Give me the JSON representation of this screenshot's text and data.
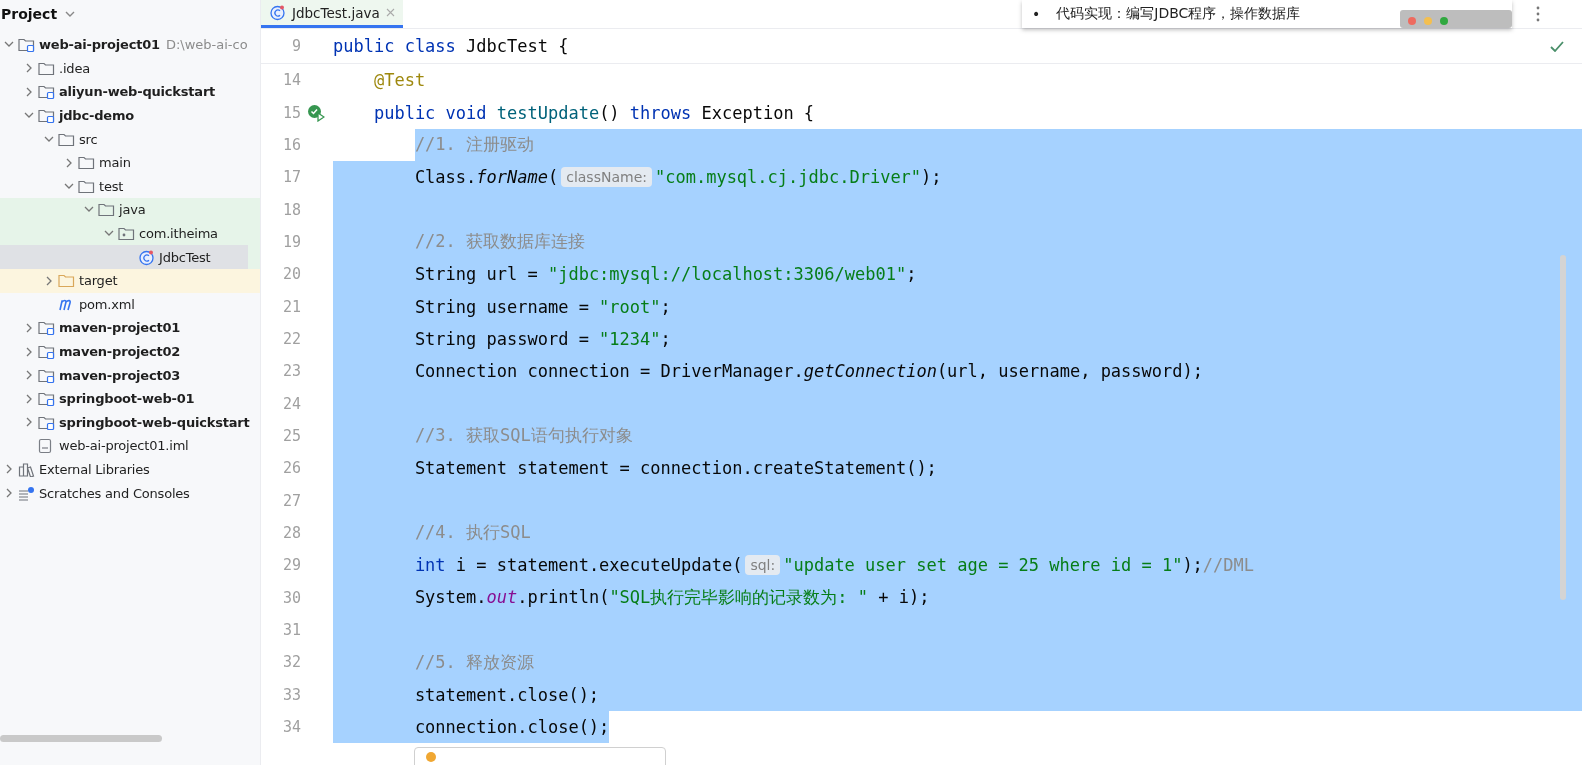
{
  "sidebar": {
    "title": "Project",
    "tree": [
      {
        "label": "web-ai-project01",
        "bold": true,
        "note": "D:\\web-ai-co",
        "kind": "module",
        "expanded": true,
        "selected": false,
        "test_source": false,
        "excluded": false,
        "children": [
          {
            "label": ".idea",
            "bold": false,
            "kind": "folder",
            "expanded": false,
            "selected": false,
            "test_source": false,
            "excluded": false
          },
          {
            "label": "aliyun-web-quickstart",
            "bold": true,
            "kind": "module",
            "expanded": false,
            "selected": false,
            "test_source": false,
            "excluded": false
          },
          {
            "label": "jdbc-demo",
            "bold": true,
            "kind": "module",
            "expanded": true,
            "selected": false,
            "test_source": false,
            "excluded": false,
            "children": [
              {
                "label": "src",
                "bold": false,
                "kind": "folder",
                "expanded": true,
                "selected": false,
                "test_source": false,
                "excluded": false,
                "children": [
                  {
                    "label": "main",
                    "bold": false,
                    "kind": "folder",
                    "expanded": false,
                    "selected": false,
                    "test_source": false,
                    "excluded": false
                  },
                  {
                    "label": "test",
                    "bold": false,
                    "kind": "folder",
                    "expanded": true,
                    "selected": false,
                    "test_source": false,
                    "excluded": false,
                    "children": [
                      {
                        "label": "java",
                        "bold": false,
                        "kind": "folder",
                        "expanded": true,
                        "selected": false,
                        "test_source": true,
                        "excluded": false,
                        "children": [
                          {
                            "label": "com.itheima",
                            "bold": false,
                            "kind": "package",
                            "expanded": true,
                            "selected": false,
                            "test_source": true,
                            "excluded": false,
                            "children": [
                              {
                                "label": "JdbcTest",
                                "bold": false,
                                "kind": "class",
                                "selected": true,
                                "test_source": true,
                                "excluded": false
                              }
                            ]
                          }
                        ]
                      }
                    ]
                  }
                ]
              },
              {
                "label": "target",
                "bold": false,
                "kind": "folder",
                "expanded": false,
                "selected": false,
                "test_source": false,
                "excluded": true
              },
              {
                "label": "pom.xml",
                "bold": false,
                "kind": "maven",
                "selected": false,
                "test_source": false,
                "excluded": false
              }
            ]
          },
          {
            "label": "maven-project01",
            "bold": true,
            "kind": "module",
            "expanded": false,
            "selected": false,
            "test_source": false,
            "excluded": false
          },
          {
            "label": "maven-project02",
            "bold": true,
            "kind": "module",
            "expanded": false,
            "selected": false,
            "test_source": false,
            "excluded": false
          },
          {
            "label": "maven-project03",
            "bold": true,
            "kind": "module",
            "expanded": false,
            "selected": false,
            "test_source": false,
            "excluded": false
          },
          {
            "label": "springboot-web-01",
            "bold": true,
            "kind": "module",
            "expanded": false,
            "selected": false,
            "test_source": false,
            "excluded": false
          },
          {
            "label": "springboot-web-quickstart",
            "bold": true,
            "kind": "module",
            "expanded": false,
            "selected": false,
            "test_source": false,
            "excluded": false
          },
          {
            "label": "web-ai-project01.iml",
            "bold": false,
            "kind": "file",
            "selected": false,
            "test_source": false,
            "excluded": false
          }
        ]
      },
      {
        "label": "External Libraries",
        "bold": false,
        "kind": "libraries",
        "expanded": false,
        "selected": false,
        "test_source": false,
        "excluded": false
      },
      {
        "label": "Scratches and Consoles",
        "bold": false,
        "kind": "scratches",
        "expanded": false,
        "selected": false,
        "test_source": false,
        "excluded": false
      }
    ]
  },
  "tabs": [
    {
      "label": "JdbcTest.java",
      "selected": true
    }
  ],
  "note": {
    "bullet": "•",
    "text": "代码实现：编写JDBC程序，操作数据库"
  },
  "sticky_line": {
    "number": "9",
    "tokens": [
      {
        "kind": "keyword",
        "text": "public class"
      },
      {
        "kind": "plain",
        "text": " JdbcTest {"
      }
    ]
  },
  "lines": [
    {
      "number": "14",
      "kind": "member",
      "selected": false,
      "tokens": [
        {
          "kind": "annotation",
          "text": "@Test"
        }
      ]
    },
    {
      "number": "15",
      "kind": "member",
      "selected": false,
      "run": true,
      "tokens": [
        {
          "kind": "keyword",
          "text": "public void"
        },
        {
          "kind": "decl",
          "text": " testUpdate"
        },
        {
          "kind": "plain",
          "text": "() "
        },
        {
          "kind": "keyword",
          "text": "throws"
        },
        {
          "kind": "plain",
          "text": " Exception {"
        }
      ]
    },
    {
      "number": "16",
      "kind": "body",
      "selected": true,
      "selection_starts": true,
      "tokens": [
        {
          "kind": "comment",
          "text": "//1. 注册驱动"
        }
      ]
    },
    {
      "number": "17",
      "kind": "body",
      "selected": true,
      "selection_starts": false,
      "selection_ends": false,
      "tokens": [
        {
          "kind": "plain",
          "text": "Class."
        },
        {
          "kind": "italic",
          "text": "forName"
        },
        {
          "kind": "plain",
          "text": "("
        },
        {
          "kind": "hint",
          "text": "className:"
        },
        {
          "kind": "string",
          "text": "\"com.mysql.cj.jdbc.Driver\""
        },
        {
          "kind": "plain",
          "text": ");"
        }
      ]
    },
    {
      "number": "18",
      "kind": "body",
      "selected": true,
      "selection_starts": false,
      "selection_ends": false
    },
    {
      "number": "19",
      "kind": "body",
      "selected": true,
      "selection_starts": false,
      "selection_ends": false,
      "tokens": [
        {
          "kind": "comment",
          "text": "//2. 获取数据库连接"
        }
      ]
    },
    {
      "number": "20",
      "kind": "body",
      "selected": true,
      "selection_starts": false,
      "selection_ends": false,
      "tokens": [
        {
          "kind": "plain",
          "text": "String url = "
        },
        {
          "kind": "string",
          "text": "\"jdbc:mysql://localhost:3306/web01\""
        },
        {
          "kind": "plain",
          "text": ";"
        }
      ]
    },
    {
      "number": "21",
      "kind": "body",
      "selected": true,
      "selection_starts": false,
      "selection_ends": false,
      "tokens": [
        {
          "kind": "plain",
          "text": "String username = "
        },
        {
          "kind": "string",
          "text": "\"root\""
        },
        {
          "kind": "plain",
          "text": ";"
        }
      ]
    },
    {
      "number": "22",
      "kind": "body",
      "selected": true,
      "selection_starts": false,
      "selection_ends": false,
      "tokens": [
        {
          "kind": "plain",
          "text": "String password = "
        },
        {
          "kind": "string",
          "text": "\"1234\""
        },
        {
          "kind": "plain",
          "text": ";"
        }
      ]
    },
    {
      "number": "23",
      "kind": "body",
      "selected": true,
      "selection_starts": false,
      "selection_ends": false,
      "tokens": [
        {
          "kind": "plain",
          "text": "Connection connection = DriverManager."
        },
        {
          "kind": "italic",
          "text": "getConnection"
        },
        {
          "kind": "plain",
          "text": "(url, username, password);"
        }
      ]
    },
    {
      "number": "24",
      "kind": "body",
      "selected": true,
      "selection_starts": false,
      "selection_ends": false
    },
    {
      "number": "25",
      "kind": "body",
      "selected": true,
      "selection_starts": false,
      "selection_ends": false,
      "tokens": [
        {
          "kind": "comment",
          "text": "//3. 获取SQL语句执行对象"
        }
      ]
    },
    {
      "number": "26",
      "kind": "body",
      "selected": true,
      "selection_starts": false,
      "selection_ends": false,
      "tokens": [
        {
          "kind": "plain",
          "text": "Statement statement = connection.createStatement();"
        }
      ]
    },
    {
      "number": "27",
      "kind": "body",
      "selected": true,
      "selection_starts": false,
      "selection_ends": false
    },
    {
      "number": "28",
      "kind": "body",
      "selected": true,
      "selection_starts": false,
      "selection_ends": false,
      "tokens": [
        {
          "kind": "comment",
          "text": "//4. 执行SQL"
        }
      ]
    },
    {
      "number": "29",
      "kind": "body",
      "selected": true,
      "selection_starts": false,
      "selection_ends": false,
      "tokens": [
        {
          "kind": "keyword",
          "text": "int"
        },
        {
          "kind": "plain",
          "text": " i = statement.executeUpdate("
        },
        {
          "kind": "hint",
          "text": "sql:"
        },
        {
          "kind": "string",
          "text": "\"update user set age = 25 where id = 1\""
        },
        {
          "kind": "plain",
          "text": ");"
        },
        {
          "kind": "comment",
          "text": "//DML"
        }
      ]
    },
    {
      "number": "30",
      "kind": "body",
      "selected": true,
      "selection_starts": false,
      "selection_ends": false,
      "tokens": [
        {
          "kind": "plain",
          "text": "System."
        },
        {
          "kind": "static",
          "text": "out"
        },
        {
          "kind": "plain",
          "text": ".println("
        },
        {
          "kind": "string",
          "text": "\"SQL执行完毕影响的记录数为: \""
        },
        {
          "kind": "plain",
          "text": " + i);"
        }
      ]
    },
    {
      "number": "31",
      "kind": "body",
      "selected": true,
      "selection_starts": false,
      "selection_ends": false
    },
    {
      "number": "32",
      "kind": "body",
      "selected": true,
      "selection_starts": false,
      "selection_ends": false,
      "tokens": [
        {
          "kind": "comment",
          "text": "//5. 释放资源"
        }
      ]
    },
    {
      "number": "33",
      "kind": "body",
      "selected": true,
      "selection_starts": false,
      "selection_ends": false,
      "tokens": [
        {
          "kind": "plain",
          "text": "statement.close();"
        }
      ]
    },
    {
      "number": "34",
      "kind": "body",
      "selected": true,
      "selection_ends": true,
      "tokens": [
        {
          "kind": "plain",
          "text": "connection.close();"
        }
      ]
    }
  ]
}
